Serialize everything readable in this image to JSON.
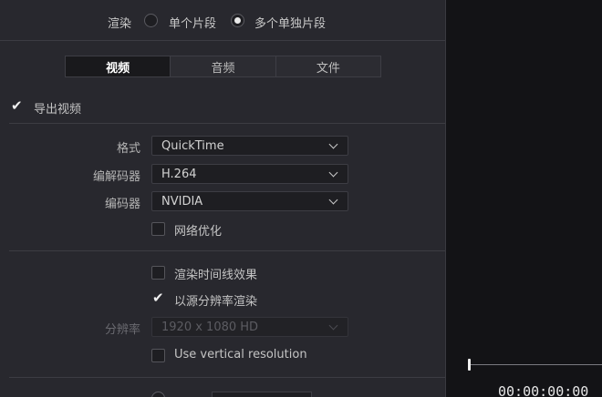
{
  "render": {
    "label": "渲染",
    "options": [
      {
        "label": "单个片段",
        "selected": false
      },
      {
        "label": "多个单独片段",
        "selected": true
      }
    ]
  },
  "tabs": [
    {
      "label": "视频",
      "active": true
    },
    {
      "label": "音频",
      "active": false
    },
    {
      "label": "文件",
      "active": false
    }
  ],
  "export_video": {
    "label": "导出视频",
    "checked": true
  },
  "format": {
    "label": "格式",
    "value": "QuickTime"
  },
  "codec": {
    "label": "编解码器",
    "value": "H.264"
  },
  "encoder": {
    "label": "编码器",
    "value": "NVIDIA"
  },
  "network_optimize": {
    "label": "网络优化",
    "checked": false
  },
  "render_timeline_effects": {
    "label": "渲染时间线效果",
    "checked": false
  },
  "render_source_resolution": {
    "label": "以源分辨率渲染",
    "checked": true
  },
  "resolution": {
    "label": "分辨率",
    "value": "1920 x 1080 HD",
    "disabled": true
  },
  "vertical_resolution": {
    "label": "Use vertical resolution",
    "checked": false
  },
  "viewer": {
    "timecode": "00:00:00:00"
  },
  "colors": {
    "panel": "#28282e",
    "viewer": "#131316",
    "active_tab": "#19191c"
  }
}
